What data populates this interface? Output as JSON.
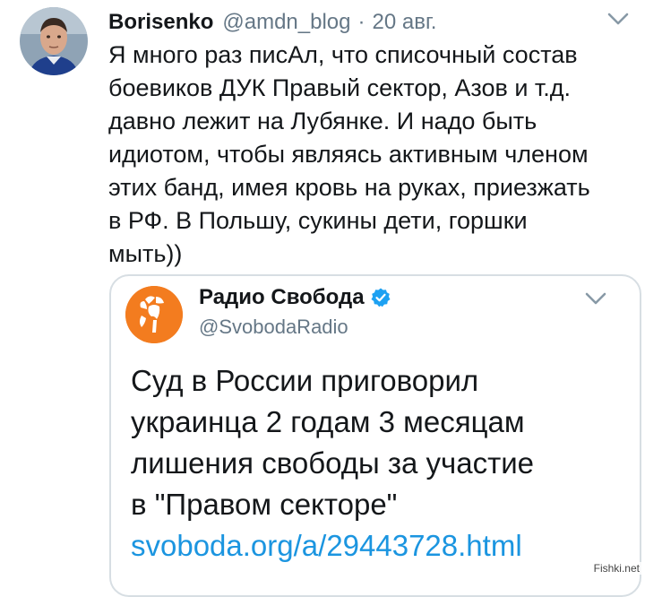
{
  "tweet": {
    "author_name": "Borisenko",
    "author_handle": "@amdn_blog",
    "separator": "·",
    "time": "20 авг.",
    "text": "Я много раз писАл, что списочный состав\nбоевиков ДУК Правый сектор, Азов и т.д.\nдавно лежит на Лубянке. И надо быть\nидиотом, чтобы являясь активным членом\nэтих банд, имея кровь на руках, приезжать\nв РФ. В Польшу, сукины дети, горшки\nмыть))"
  },
  "quoted": {
    "author_name": "Радио Свобода",
    "author_handle": "@SvobodaRadio",
    "text": "Суд в России приговорил\nукраинца  2 годам 3 месяцам\nлишения свободы за участие\nв \"Правом секторе\"",
    "link": "svoboda.org/a/29443728.html"
  },
  "watermark": "Fishki.net",
  "colors": {
    "text": "#14171a",
    "secondary": "#657786",
    "link": "#1b95e0",
    "verified": "#1da1f2",
    "radio_logo": "#f37c1f",
    "border": "#d7dee3"
  },
  "icons": [
    "chevron-down-icon",
    "verified-badge-icon",
    "radio-svoboda-logo-icon"
  ]
}
